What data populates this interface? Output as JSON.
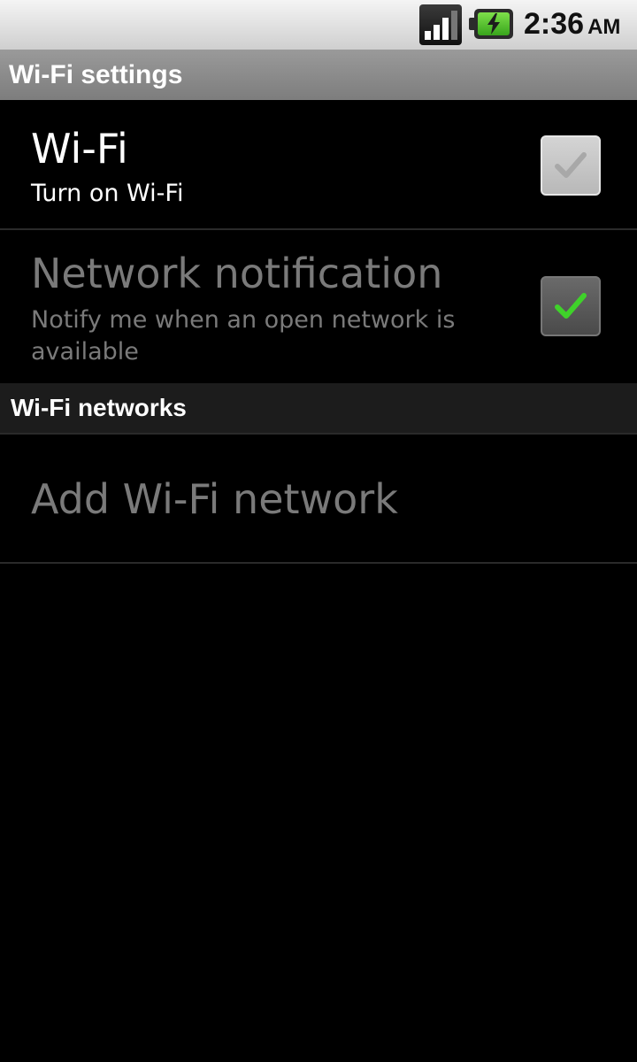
{
  "status_bar": {
    "time": "2:36",
    "ampm": "AM",
    "signal_icon": "signal-icon",
    "battery_icon": "battery-charging-icon",
    "colors": {
      "battery": "#4cc02a"
    }
  },
  "title_bar": {
    "title": "Wi-Fi settings"
  },
  "wifi_pref": {
    "title": "Wi-Fi",
    "summary": "Turn on Wi-Fi",
    "checked": true,
    "enabled": false
  },
  "network_notification_pref": {
    "title": "Network notification",
    "summary": "Notify me when an open network is available",
    "checked": true,
    "enabled": false
  },
  "section": {
    "title": "Wi-Fi networks"
  },
  "add_network": {
    "label": "Add Wi-Fi network"
  },
  "colors": {
    "background": "#000000",
    "disabled_text": "#7a7a7a",
    "check_green": "#3fd22a"
  }
}
